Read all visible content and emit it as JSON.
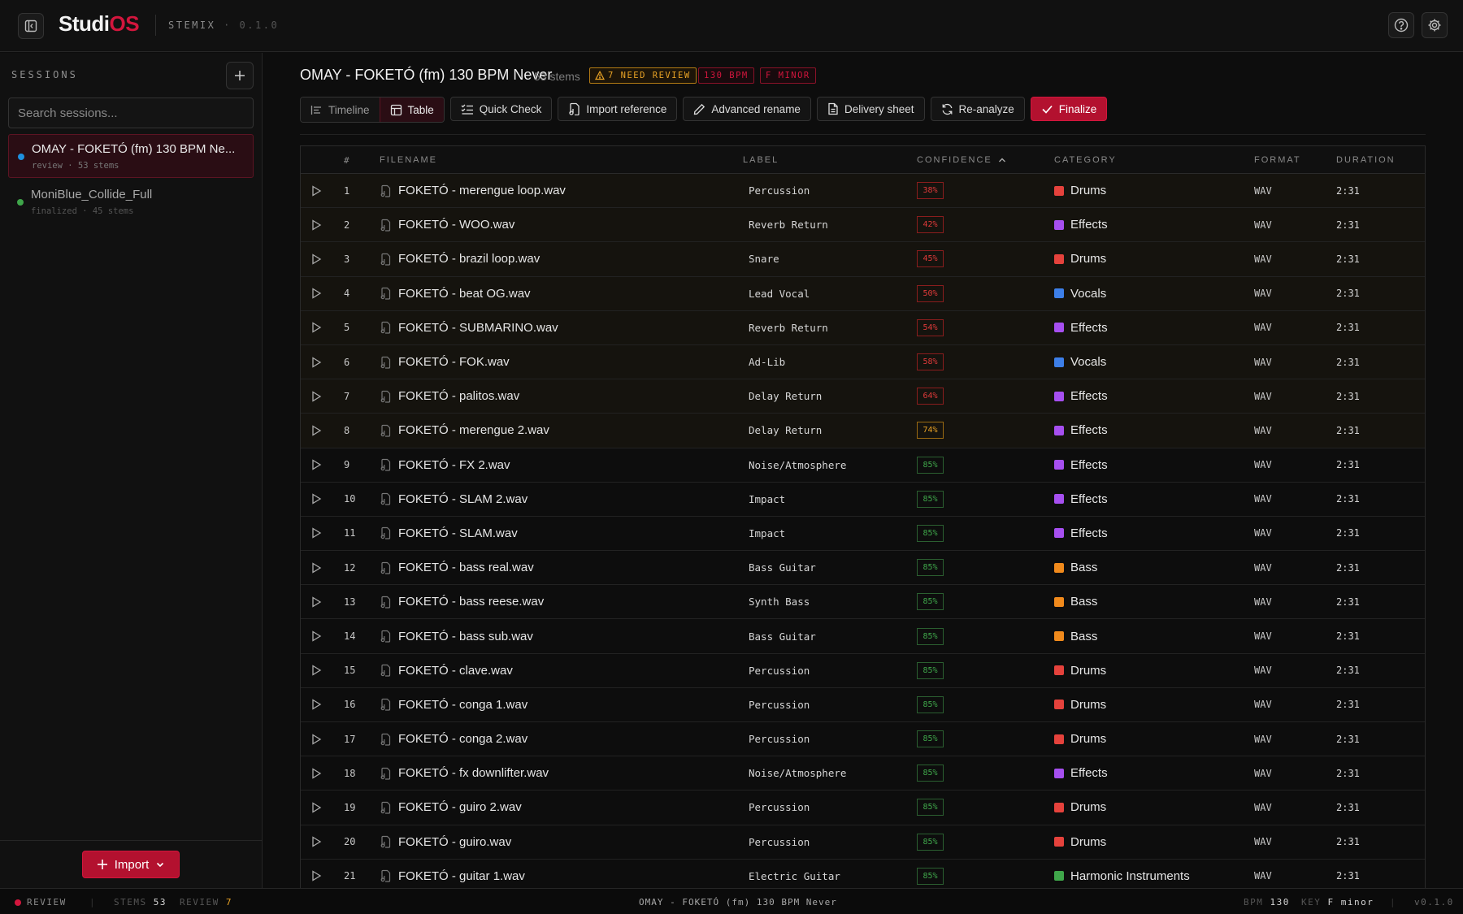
{
  "brand": {
    "part1": "Studi",
    "part2": "OS"
  },
  "app": {
    "name": "STEMIX",
    "version": "0.1.0"
  },
  "sidebar": {
    "heading": "SESSIONS",
    "search_placeholder": "Search sessions...",
    "sessions": [
      {
        "name": "OMAY - FOKETÓ (fm) 130 BPM Ne...",
        "meta": "review · 53 stems",
        "dot_color": "#1e90e0"
      },
      {
        "name": "MoniBlue_Collide_Full",
        "meta": "finalized · 45 stems",
        "dot_color": "#3fa64a"
      }
    ],
    "import_label": "Import"
  },
  "session": {
    "title": "OMAY - FOKETÓ (fm) 130 BPM Never",
    "stem_count": "53 stems",
    "badges": {
      "review": "7 NEED REVIEW",
      "bpm": "130 BPM",
      "key": "F MINOR"
    }
  },
  "toolbar": {
    "timeline": "Timeline",
    "table": "Table",
    "quick_check": "Quick Check",
    "import_reference": "Import reference",
    "advanced_rename": "Advanced rename",
    "delivery_sheet": "Delivery sheet",
    "reanalyze": "Re-analyze",
    "finalize": "Finalize"
  },
  "table": {
    "columns": {
      "num": "#",
      "filename": "FILENAME",
      "label": "LABEL",
      "confidence": "CONFIDENCE",
      "category": "CATEGORY",
      "format": "FORMAT",
      "duration": "DURATION"
    },
    "category_colors": {
      "Drums": "#e5423c",
      "Effects": "#a64ff0",
      "Vocals": "#3d7fe8",
      "Bass": "#f08a1c",
      "Harmonic Instruments": "#3fa64a"
    },
    "rows": [
      {
        "num": "1",
        "file": "FOKETÓ - merengue loop.wav",
        "label": "Percussion",
        "conf": "38%",
        "level": "low",
        "category": "Drums",
        "format": "WAV",
        "duration": "2:31"
      },
      {
        "num": "2",
        "file": "FOKETÓ - WOO.wav",
        "label": "Reverb Return",
        "conf": "42%",
        "level": "low",
        "category": "Effects",
        "format": "WAV",
        "duration": "2:31"
      },
      {
        "num": "3",
        "file": "FOKETÓ - brazil loop.wav",
        "label": "Snare",
        "conf": "45%",
        "level": "low",
        "category": "Drums",
        "format": "WAV",
        "duration": "2:31"
      },
      {
        "num": "4",
        "file": "FOKETÓ - beat OG.wav",
        "label": "Lead Vocal",
        "conf": "50%",
        "level": "low",
        "category": "Vocals",
        "format": "WAV",
        "duration": "2:31"
      },
      {
        "num": "5",
        "file": "FOKETÓ - SUBMARINO.wav",
        "label": "Reverb Return",
        "conf": "54%",
        "level": "low",
        "category": "Effects",
        "format": "WAV",
        "duration": "2:31"
      },
      {
        "num": "6",
        "file": "FOKETÓ - FOK.wav",
        "label": "Ad-Lib",
        "conf": "58%",
        "level": "low",
        "category": "Vocals",
        "format": "WAV",
        "duration": "2:31"
      },
      {
        "num": "7",
        "file": "FOKETÓ - palitos.wav",
        "label": "Delay Return",
        "conf": "64%",
        "level": "low",
        "category": "Effects",
        "format": "WAV",
        "duration": "2:31"
      },
      {
        "num": "8",
        "file": "FOKETÓ - merengue 2.wav",
        "label": "Delay Return",
        "conf": "74%",
        "level": "mid",
        "category": "Effects",
        "format": "WAV",
        "duration": "2:31"
      },
      {
        "num": "9",
        "file": "FOKETÓ - FX 2.wav",
        "label": "Noise/Atmosphere",
        "conf": "85%",
        "level": "high",
        "category": "Effects",
        "format": "WAV",
        "duration": "2:31"
      },
      {
        "num": "10",
        "file": "FOKETÓ - SLAM 2.wav",
        "label": "Impact",
        "conf": "85%",
        "level": "high",
        "category": "Effects",
        "format": "WAV",
        "duration": "2:31"
      },
      {
        "num": "11",
        "file": "FOKETÓ - SLAM.wav",
        "label": "Impact",
        "conf": "85%",
        "level": "high",
        "category": "Effects",
        "format": "WAV",
        "duration": "2:31"
      },
      {
        "num": "12",
        "file": "FOKETÓ - bass real.wav",
        "label": "Bass Guitar",
        "conf": "85%",
        "level": "high",
        "category": "Bass",
        "format": "WAV",
        "duration": "2:31"
      },
      {
        "num": "13",
        "file": "FOKETÓ - bass reese.wav",
        "label": "Synth Bass",
        "conf": "85%",
        "level": "high",
        "category": "Bass",
        "format": "WAV",
        "duration": "2:31"
      },
      {
        "num": "14",
        "file": "FOKETÓ - bass sub.wav",
        "label": "Bass Guitar",
        "conf": "85%",
        "level": "high",
        "category": "Bass",
        "format": "WAV",
        "duration": "2:31"
      },
      {
        "num": "15",
        "file": "FOKETÓ - clave.wav",
        "label": "Percussion",
        "conf": "85%",
        "level": "high",
        "category": "Drums",
        "format": "WAV",
        "duration": "2:31"
      },
      {
        "num": "16",
        "file": "FOKETÓ - conga 1.wav",
        "label": "Percussion",
        "conf": "85%",
        "level": "high",
        "category": "Drums",
        "format": "WAV",
        "duration": "2:31"
      },
      {
        "num": "17",
        "file": "FOKETÓ - conga 2.wav",
        "label": "Percussion",
        "conf": "85%",
        "level": "high",
        "category": "Drums",
        "format": "WAV",
        "duration": "2:31"
      },
      {
        "num": "18",
        "file": "FOKETÓ - fx downlifter.wav",
        "label": "Noise/Atmosphere",
        "conf": "85%",
        "level": "high",
        "category": "Effects",
        "format": "WAV",
        "duration": "2:31"
      },
      {
        "num": "19",
        "file": "FOKETÓ - guiro 2.wav",
        "label": "Percussion",
        "conf": "85%",
        "level": "high",
        "category": "Drums",
        "format": "WAV",
        "duration": "2:31"
      },
      {
        "num": "20",
        "file": "FOKETÓ - guiro.wav",
        "label": "Percussion",
        "conf": "85%",
        "level": "high",
        "category": "Drums",
        "format": "WAV",
        "duration": "2:31"
      },
      {
        "num": "21",
        "file": "FOKETÓ - guitar 1.wav",
        "label": "Electric Guitar",
        "conf": "85%",
        "level": "high",
        "category": "Harmonic Instruments",
        "format": "WAV",
        "duration": "2:31"
      }
    ]
  },
  "statusbar": {
    "state": "REVIEW",
    "stems_key": "STEMS",
    "stems_val": "53",
    "review_key": "REVIEW",
    "review_val": "7",
    "center": "OMAY - FOKETÓ (fm) 130 BPM Never",
    "bpm_key": "BPM",
    "bpm_val": "130",
    "key_key": "KEY",
    "key_val": "F minor",
    "version": "v0.1.0"
  }
}
